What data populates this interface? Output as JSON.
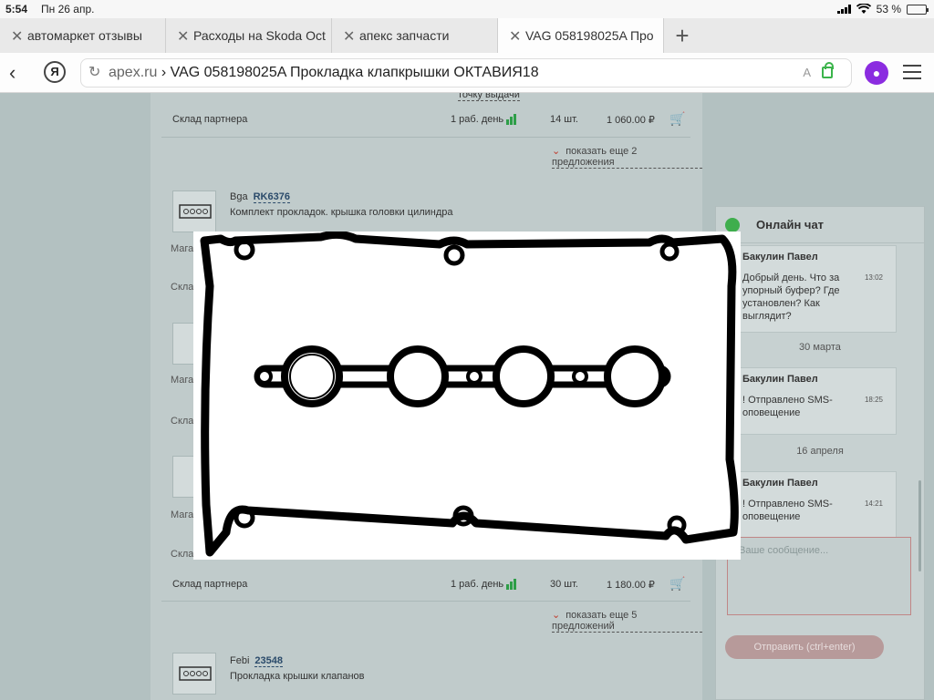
{
  "status": {
    "time": "5:54",
    "date": "Пн 26 апр.",
    "battery": "53 %",
    "battery_level": 0.53
  },
  "tabs": [
    {
      "label": "автомаркет отзывы",
      "active": false
    },
    {
      "label": "Расходы на Skoda Oct",
      "active": false
    },
    {
      "label": "апекс запчасти",
      "active": false
    },
    {
      "label": "VAG 058198025A Про",
      "active": true
    }
  ],
  "address": {
    "host": "apex.ru",
    "sep": " › ",
    "title": "VAG 058198025A Прокладка клапкрышки ОКТАВИЯ18",
    "reader": "A"
  },
  "listing": {
    "partial_top": "точку выдачи",
    "row1": {
      "store": "Склад партнера",
      "delivery": "1 раб. день",
      "qty": "14 шт.",
      "price": "1 060.00 ₽"
    },
    "more1": "показать еще 2 предложения",
    "item2": {
      "brand": "Bga",
      "code": "RK6376",
      "desc": "Комплект прокладок. крышка головки цилиндра"
    },
    "stub_mag": "Мага",
    "stub_sklad": "Склад",
    "row_last": {
      "store": "Склад партнера",
      "delivery": "1 раб. день",
      "qty": "30 шт.",
      "price": "1 180.00 ₽"
    },
    "more2": "показать еще 5 предложений",
    "item_last": {
      "brand": "Febi",
      "code": "23548",
      "desc": "Прокладка крышки клапанов"
    }
  },
  "chat": {
    "title": "Онлайн чат",
    "messages": [
      {
        "author": "Бакулин Павел",
        "text": "Добрый день. Что за упорный буфер? Где установлен? Как выглядит?",
        "time": "13:02"
      },
      {
        "day": "30 марта"
      },
      {
        "author": "Бакулин Павел",
        "text": "! Отправлено SMS-оповещение",
        "time": "18:25"
      },
      {
        "day": "16 апреля"
      },
      {
        "author": "Бакулин Павел",
        "text": "! Отправлено SMS-оповещение",
        "time": "14:21"
      }
    ],
    "input_placeholder": "Ваше сообщение...",
    "send_label": "Отправить (ctrl+enter)"
  },
  "overlay": {
    "icon": "valve-cover-gasket-image"
  },
  "colors": {
    "accent_green": "#3fae4d",
    "voice_purple": "#8b2ce0",
    "cart_red": "#c0392b"
  }
}
